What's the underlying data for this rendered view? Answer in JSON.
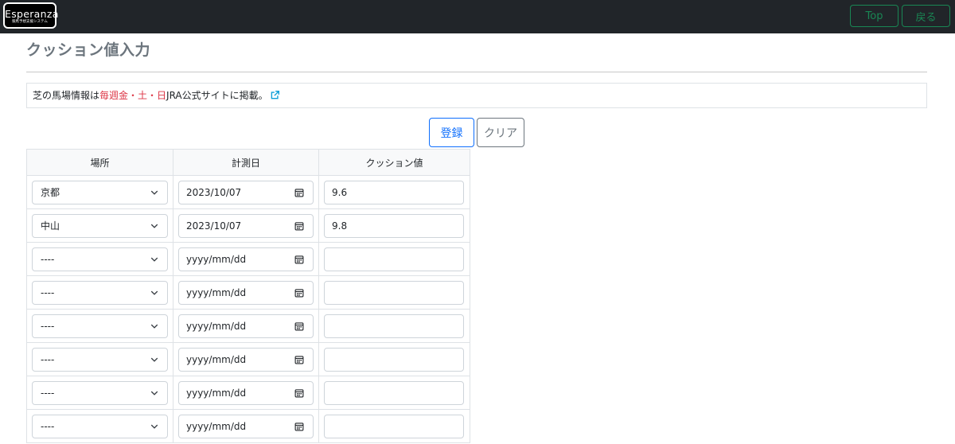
{
  "navbar": {
    "logo_text": "Esperanza",
    "logo_subtext": "競馬予想支援システム",
    "top_label": "Top",
    "back_label": "戻る",
    "nav_color": "#198754",
    "bg_color": "#212529"
  },
  "page": {
    "title": "クッション値入力"
  },
  "info": {
    "prefix": "芝の馬場情報は",
    "highlight": "毎週金・土・日",
    "suffix": "JRA公式サイトに掲載。",
    "highlight_color": "#dc3545",
    "link_icon": "external-link-icon"
  },
  "actions": {
    "register_label": "登録",
    "clear_label": "クリア"
  },
  "table": {
    "headers": [
      "場所",
      "計測日",
      "クッション値"
    ],
    "rows": [
      {
        "place": "京都",
        "date": "2023/10/07",
        "value": "9.6"
      },
      {
        "place": "中山",
        "date": "2023/10/07",
        "value": "9.8"
      },
      {
        "place": "----",
        "date": "yyyy/mm/dd",
        "value": ""
      },
      {
        "place": "----",
        "date": "yyyy/mm/dd",
        "value": ""
      },
      {
        "place": "----",
        "date": "yyyy/mm/dd",
        "value": ""
      },
      {
        "place": "----",
        "date": "yyyy/mm/dd",
        "value": ""
      },
      {
        "place": "----",
        "date": "yyyy/mm/dd",
        "value": ""
      },
      {
        "place": "----",
        "date": "yyyy/mm/dd",
        "value": ""
      }
    ]
  }
}
